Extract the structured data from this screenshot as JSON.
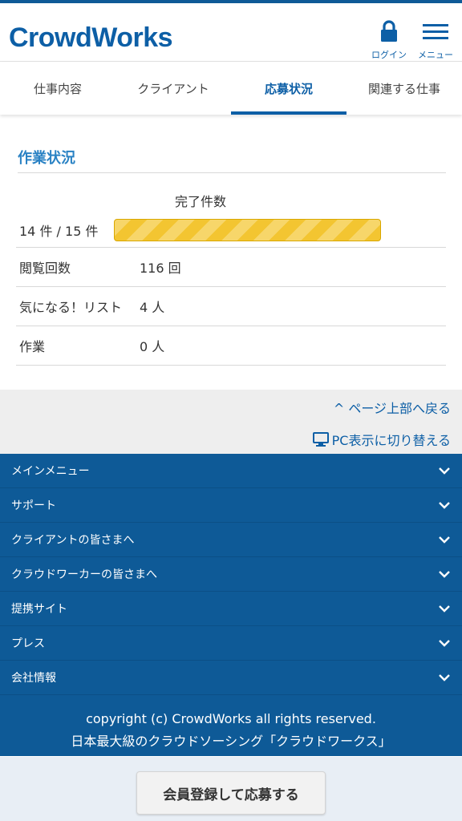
{
  "header": {
    "logo": "CrowdWorks",
    "login_label": "ログイン",
    "menu_label": "メニュー"
  },
  "tabs": [
    {
      "label": "仕事内容",
      "active": false
    },
    {
      "label": "クライアント",
      "active": false
    },
    {
      "label": "応募状況",
      "active": true
    },
    {
      "label": "関連する仕事",
      "active": false
    }
  ],
  "work_status": {
    "title": "作業状況",
    "completion_label": "完了件数",
    "completion_text": "14 件 / 15 件",
    "completion_fraction": 0.933,
    "stats": [
      {
        "label": "閲覧回数",
        "value": "116 回"
      },
      {
        "label": "気になる！リスト",
        "value": "4 人"
      },
      {
        "label": "作業",
        "value": "0 人"
      }
    ]
  },
  "links": {
    "back_to_top": "ページ上部へ戻る",
    "pc_view": "PC表示に切り替える"
  },
  "footer_menu": [
    "メインメニュー",
    "サポート",
    "クライアントの皆さまへ",
    "クラウドワーカーの皆さまへ",
    "提携サイト",
    "プレス",
    "会社情報"
  ],
  "copyright": {
    "line1": "copyright (c) CrowdWorks all rights reserved.",
    "line2": "日本最大級のクラウドソーシング「クラウドワークス」"
  },
  "cta": {
    "label": "会員登録して応募する"
  },
  "colors": {
    "brand": "#0d5fa6",
    "footer_bg": "#0e5a97",
    "progress": "#f3c531"
  }
}
